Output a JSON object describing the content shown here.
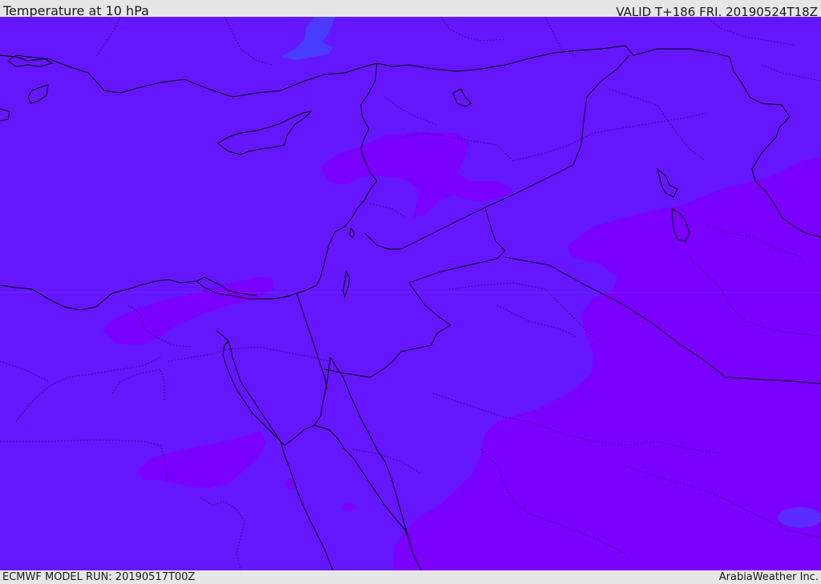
{
  "header": {
    "title": "Temperature at 10 hPa",
    "valid": "VALID T+186 FRI. 20190524T18Z"
  },
  "footer": {
    "model_run": "ECMWF MODEL RUN: 20190517T00Z",
    "credit": "ArabiaWeather Inc."
  },
  "colors": {
    "base_field": "#6416ff",
    "warm_field": "#7a00ff",
    "cool_field": "#4a3cff",
    "coastline": "#000000",
    "header_background": "#e6e6e6",
    "text": "#1a1a1a"
  },
  "map": {
    "variable": "Temperature",
    "level": "10 hPa",
    "model": "ECMWF",
    "lead_time": "T+186"
  }
}
